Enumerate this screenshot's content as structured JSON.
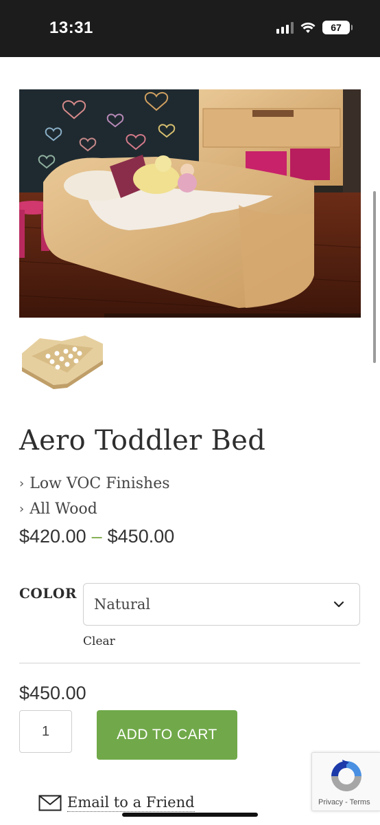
{
  "status_bar": {
    "time": "13:31",
    "battery": "67",
    "icons": [
      "signal-icon",
      "wifi-icon",
      "battery-icon"
    ]
  },
  "product": {
    "main_image_alt": "Aero Toddler Bed photo",
    "thumbnail_alt": "Aero Toddler Bed thumbnail",
    "title": "Aero Toddler Bed",
    "features": [
      "Low VOC Finishes",
      "All Wood"
    ],
    "price_min": "$420.00",
    "price_separator": "–",
    "price_max": "$450.00"
  },
  "variations": {
    "color_label": "COLOR",
    "color_value": "Natural",
    "clear_label": "Clear"
  },
  "purchase": {
    "variation_price": "$450.00",
    "quantity": "1",
    "add_to_cart_label": "ADD TO CART"
  },
  "share": {
    "email_label": "Email to a Friend"
  },
  "recaptcha": {
    "text": "Privacy - Terms"
  },
  "colors": {
    "accent_green": "#71a94a",
    "status_bar_bg": "#1c1c1c"
  }
}
